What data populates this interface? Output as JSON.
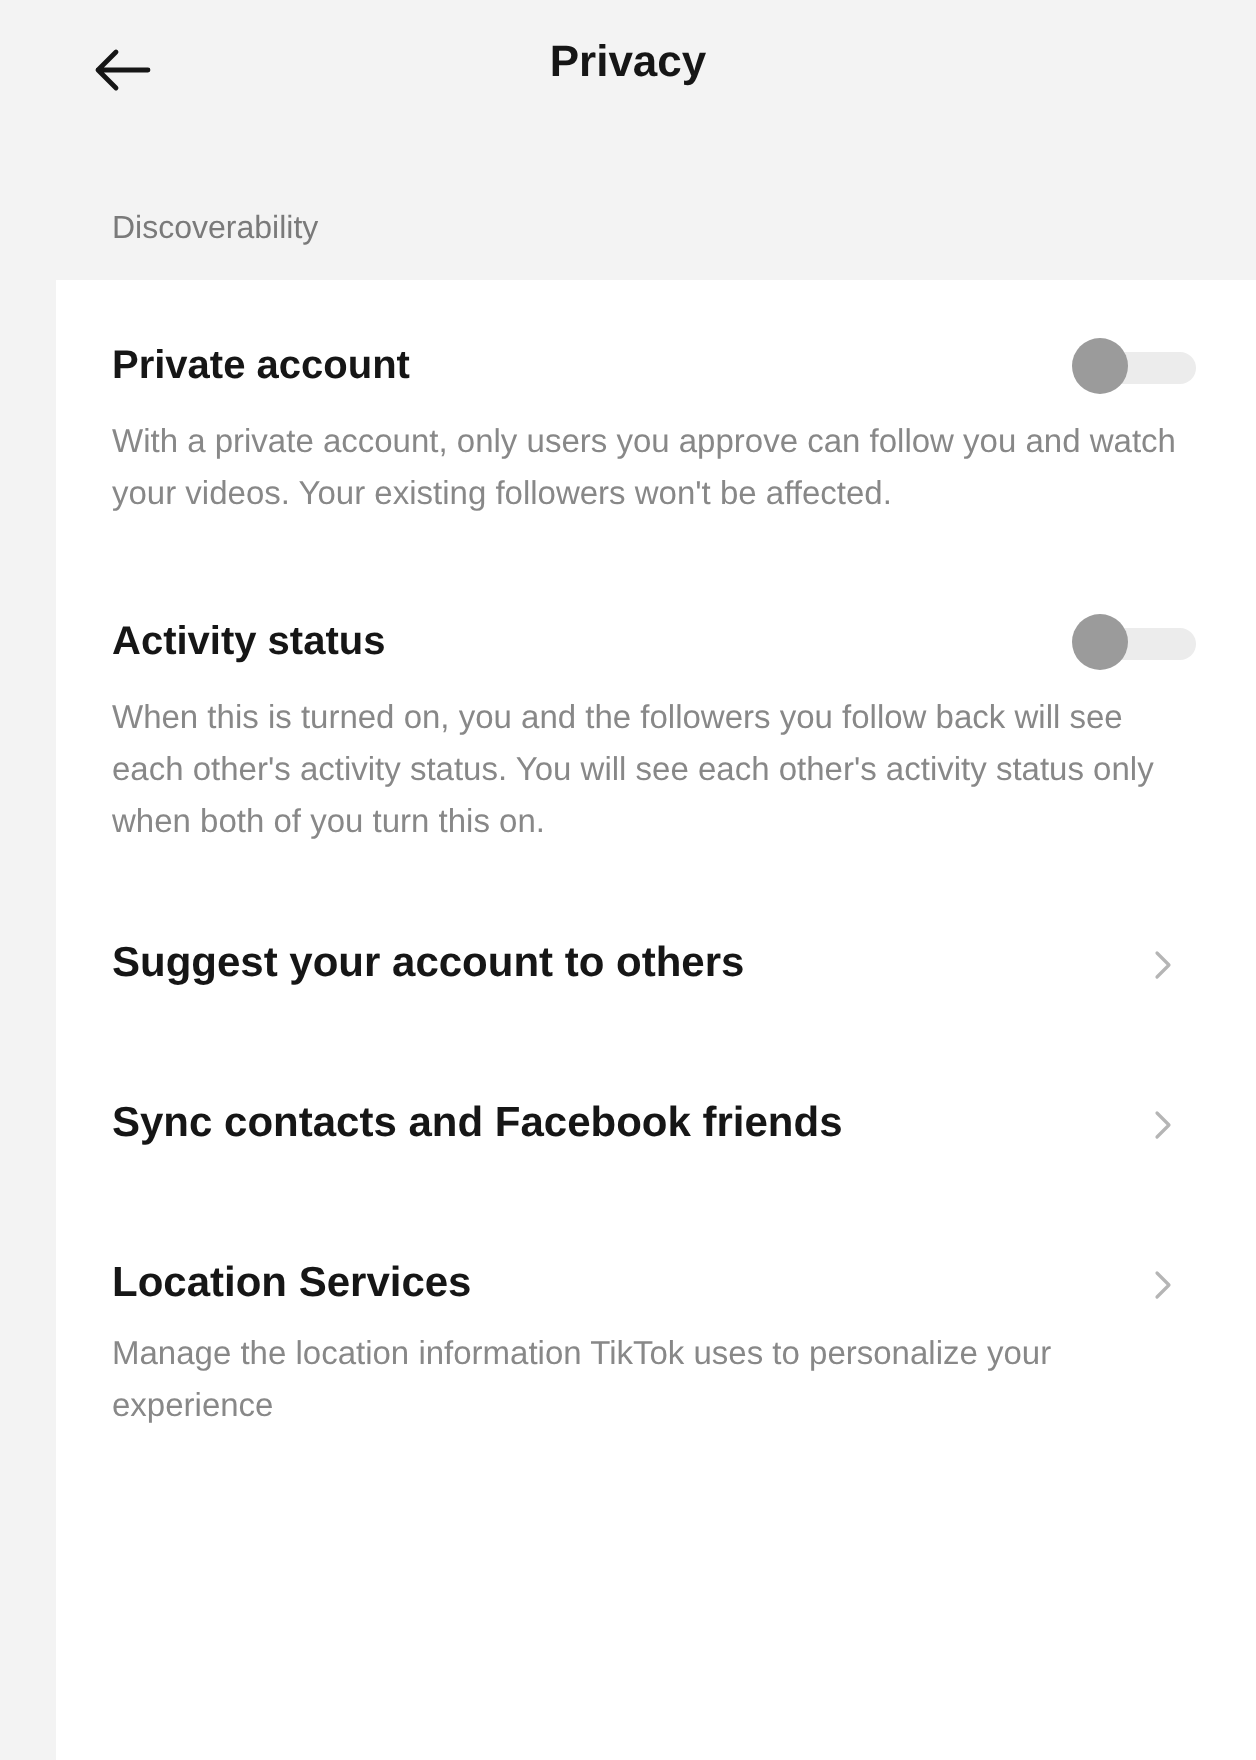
{
  "header": {
    "title": "Privacy"
  },
  "section": {
    "label": "Discoverability"
  },
  "items": [
    {
      "kind": "toggle",
      "title": "Private account",
      "on": false,
      "description": "With a private account, only users you approve can follow you and watch your videos. Your existing followers won't be affected."
    },
    {
      "kind": "toggle",
      "title": "Activity status",
      "on": false,
      "description": "When this is turned on, you and the followers you follow back will see each other's activity status. You will see each other's activity status only when both of you turn this on."
    },
    {
      "kind": "link",
      "title": "Suggest your account to others"
    },
    {
      "kind": "link",
      "title": "Sync contacts and Facebook friends"
    },
    {
      "kind": "link",
      "title": "Location Services",
      "description": "Manage the location information TikTok uses to personalize your experience"
    }
  ]
}
